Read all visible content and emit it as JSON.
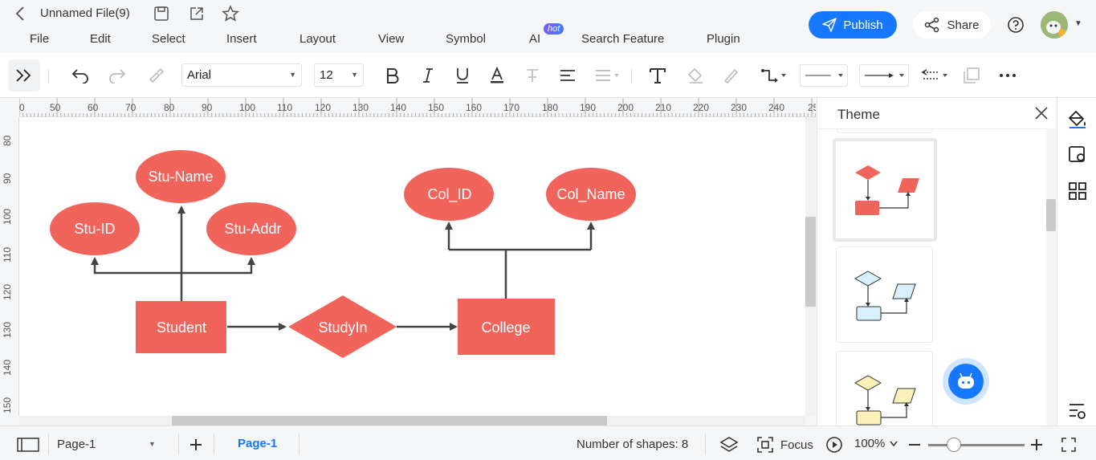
{
  "titlebar": {
    "file_title": "Unnamed File(9)",
    "publish_label": "Publish",
    "share_label": "Share"
  },
  "menu": {
    "items": [
      "File",
      "Edit",
      "Select",
      "Insert",
      "Layout",
      "View",
      "Symbol",
      "AI",
      "Search Feature",
      "Plugin"
    ],
    "hot_badge": "hot"
  },
  "toolbar": {
    "font_family": "Arial",
    "font_size": "12"
  },
  "ruler": {
    "top_labels": [
      "0",
      "50",
      "60",
      "70",
      "80",
      "90",
      "100",
      "110",
      "120",
      "130",
      "140",
      "150",
      "160",
      "170",
      "180",
      "190",
      "200",
      "210",
      "220",
      "230",
      "240",
      "25"
    ],
    "left_labels": [
      "80",
      "90",
      "100",
      "110",
      "120",
      "130",
      "140",
      "150"
    ]
  },
  "diagram": {
    "attributes": [
      "Stu-Name",
      "Stu-ID",
      "Stu-Addr",
      "Col_ID",
      "Col_Name"
    ],
    "entities": [
      "Student",
      "College"
    ],
    "relationship": "StudyIn",
    "shape_color": "#f0645c",
    "line_color": "#444444"
  },
  "theme_panel": {
    "title": "Theme"
  },
  "statusbar": {
    "page_dropdown": "Page-1",
    "active_page_tab": "Page-1",
    "shape_count": "Number of shapes: 8",
    "focus_label": "Focus",
    "zoom": "100%"
  },
  "colors": {
    "accent": "#1677ff",
    "theme1": "#f0645c",
    "theme2": "#d8f0fa",
    "theme3": "#fbf1b8"
  }
}
